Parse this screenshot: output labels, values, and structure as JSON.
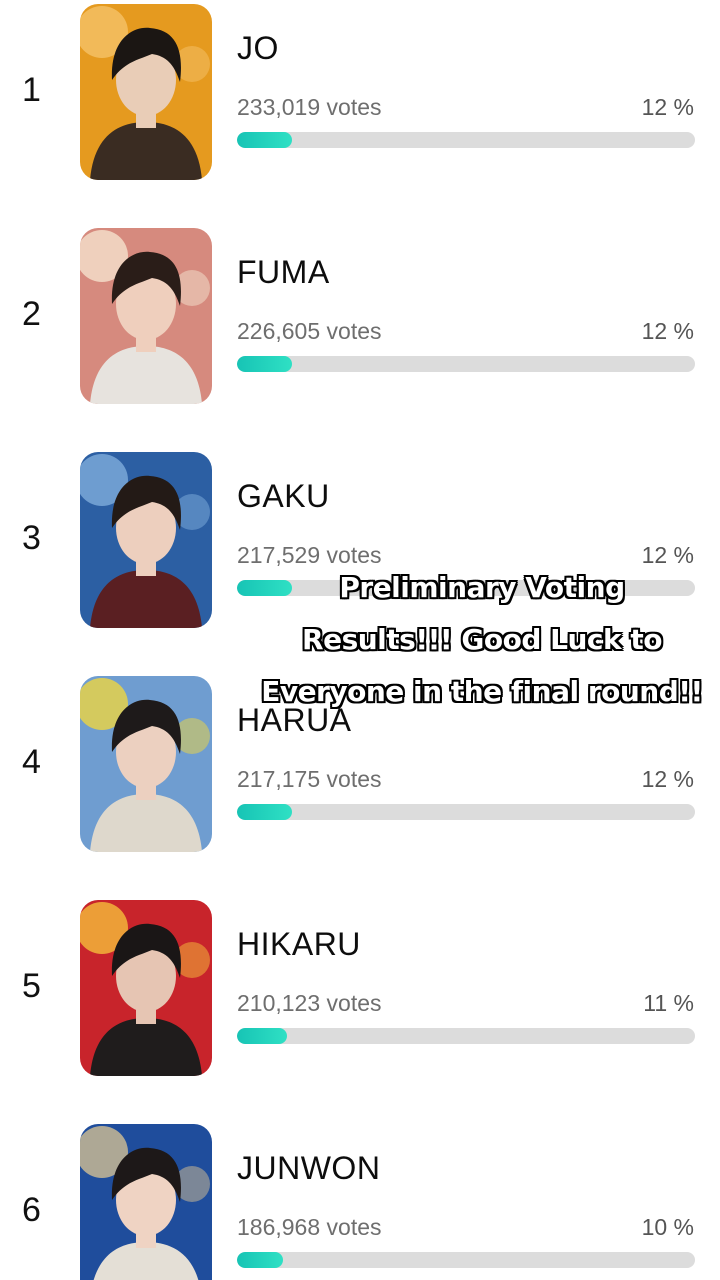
{
  "entries": [
    {
      "rank": "1",
      "name": "JO",
      "votes": "233,019 votes",
      "percent": "12 %",
      "share": 0.12,
      "colors": {
        "bg": "#e59a1f",
        "accent": "#f4c064",
        "hair": "#1b1613",
        "clothes": "#3a2c22",
        "skin": "#e9cdb7"
      }
    },
    {
      "rank": "2",
      "name": "FUMA",
      "votes": "226,605 votes",
      "percent": "12 %",
      "share": 0.12,
      "colors": {
        "bg": "#d68a7e",
        "accent": "#f3dcc8",
        "hair": "#2a1d18",
        "clothes": "#e7e3de",
        "skin": "#efcfbd"
      }
    },
    {
      "rank": "3",
      "name": "GAKU",
      "votes": "217,529 votes",
      "percent": "12 %",
      "share": 0.12,
      "colors": {
        "bg": "#2c5fa3",
        "accent": "#7aa8d8",
        "hair": "#231a16",
        "clothes": "#5a1f22",
        "skin": "#edcfbe"
      }
    },
    {
      "rank": "4",
      "name": "HARUA",
      "votes": "217,175 votes",
      "percent": "12 %",
      "share": 0.12,
      "colors": {
        "bg": "#6f9dd0",
        "accent": "#e6d24a",
        "hair": "#1e1a1a",
        "clothes": "#ded8cc",
        "skin": "#ecd0c0"
      }
    },
    {
      "rank": "5",
      "name": "HIKARU",
      "votes": "210,123 votes",
      "percent": "11 %",
      "share": 0.11,
      "colors": {
        "bg": "#c8242b",
        "accent": "#f2b43a",
        "hair": "#1a1616",
        "clothes": "#1f1c1c",
        "skin": "#e6c5b3"
      }
    },
    {
      "rank": "6",
      "name": "JUNWON",
      "votes": "186,968 votes",
      "percent": "10 %",
      "share": 0.1,
      "colors": {
        "bg": "#1f4d9c",
        "accent": "#c8b894",
        "hair": "#1d1818",
        "clothes": "#e4dfd6",
        "skin": "#efd3c3"
      }
    }
  ],
  "overlay_caption": "Preliminary Voting Results!!! Good Luck to Everyone in the final round!!",
  "icons": {
    "photo": "member-photo"
  }
}
